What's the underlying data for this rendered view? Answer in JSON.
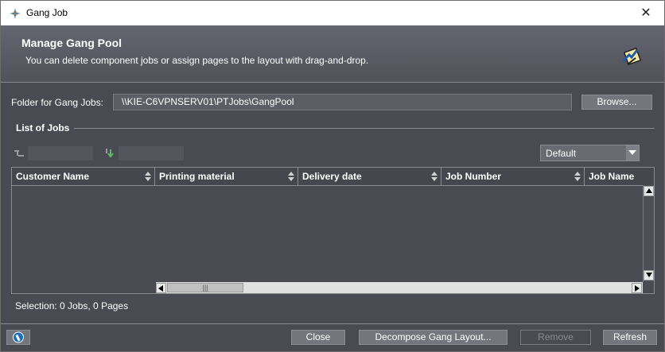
{
  "window": {
    "title": "Gang Job",
    "close_glyph": "✕"
  },
  "header": {
    "title": "Manage Gang Pool",
    "subtitle": "You can delete component jobs or assign pages to the layout with drag-and-drop.",
    "icon": "gang-pool-icon"
  },
  "folder": {
    "label": "Folder for Gang Jobs:",
    "value": "\\\\KIE-C6VPNSERV01\\PTJobs\\GangPool",
    "browse_label": "Browse..."
  },
  "jobs": {
    "section_title": "List of Jobs",
    "view_select": "Default",
    "columns": [
      "Customer Name",
      "Printing material",
      "Delivery date",
      "Job Number",
      "Job Name"
    ],
    "rows": [],
    "scroll_grip": "|||"
  },
  "selection": {
    "text": "Selection:  0 Jobs,  0 Pages"
  },
  "footer": {
    "close_label": "Close",
    "decompose_label": "Decompose Gang Layout...",
    "remove_label": "Remove",
    "refresh_label": "Refresh"
  },
  "colors": {
    "background": "#4a4a52",
    "header_top": "#656570",
    "button": "#75757d"
  }
}
